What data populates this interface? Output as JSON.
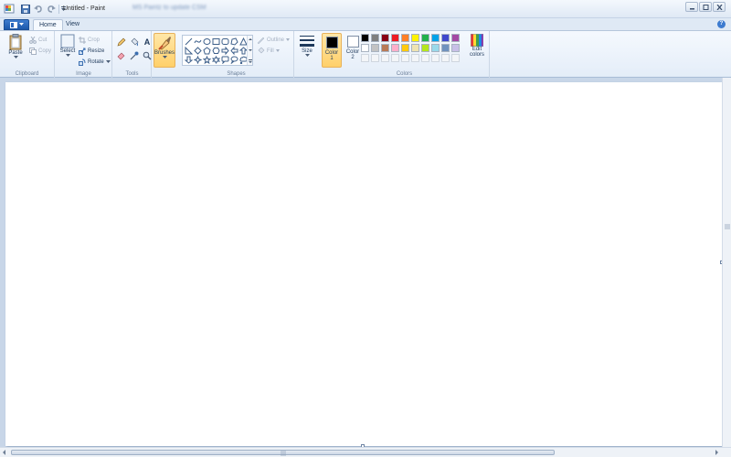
{
  "window": {
    "title": "Untitled - Paint",
    "blurred_caption": "MS Paintz to update CSM",
    "controls": [
      "minimize-icon",
      "maximize-icon",
      "close-icon"
    ]
  },
  "quick_access": [
    "save-icon",
    "undo-icon",
    "redo-icon",
    "customize-icon"
  ],
  "tabs": {
    "home": "Home",
    "view": "View"
  },
  "help_glyph": "?",
  "ribbon": {
    "clipboard": {
      "label": "Clipboard",
      "paste": "Paste",
      "cut": "Cut",
      "copy": "Copy"
    },
    "image": {
      "label": "Image",
      "select": "Select",
      "crop": "Crop",
      "resize": "Resize",
      "rotate": "Rotate"
    },
    "tools": {
      "label": "Tools",
      "text_glyph": "A"
    },
    "brushes": {
      "label": "Brushes"
    },
    "shapes": {
      "label": "Shapes",
      "outline": "Outline",
      "fill": "Fill"
    },
    "size": {
      "label": "Size"
    },
    "colors": {
      "label": "Colors",
      "color1": "Color 1",
      "color1_line1": "Color",
      "color1_line2": "1",
      "color2_line1": "Color",
      "color2_line2": "2",
      "edit_line1": "Edit",
      "edit_line2": "colors",
      "color1_value": "#000000",
      "color2_value": "#ffffff",
      "palette_row1": [
        "#000000",
        "#7f7f7f",
        "#880015",
        "#ed1c24",
        "#ff7f27",
        "#fff200",
        "#22b14c",
        "#00a2e8",
        "#3f48cc",
        "#a349a4"
      ],
      "palette_row2": [
        "#ffffff",
        "#c3c3c3",
        "#b97a57",
        "#ffaec9",
        "#ffc90e",
        "#efe4b0",
        "#b5e61d",
        "#99d9ea",
        "#7092be",
        "#c8bfe7"
      ]
    }
  },
  "accent_colors": {
    "menu_button": "#2a67bd",
    "active_highlight": "#ffd06a",
    "canvas_backdrop": "#c8d6e8"
  }
}
